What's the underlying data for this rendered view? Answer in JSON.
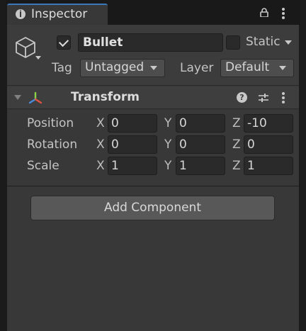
{
  "tab": {
    "label": "Inspector",
    "icon": "info-icon"
  },
  "object": {
    "active": true,
    "name": "Bullet",
    "static_label": "Static",
    "static": false,
    "tag_label": "Tag",
    "tag_value": "Untagged",
    "layer_label": "Layer",
    "layer_value": "Default"
  },
  "transform": {
    "title": "Transform",
    "rows": [
      {
        "label": "Position",
        "x": "0",
        "y": "0",
        "z": "-10"
      },
      {
        "label": "Rotation",
        "x": "0",
        "y": "0",
        "z": "0"
      },
      {
        "label": "Scale",
        "x": "1",
        "y": "1",
        "z": "1"
      }
    ],
    "axis_labels": {
      "x": "X",
      "y": "Y",
      "z": "Z"
    }
  },
  "add_component_label": "Add Component",
  "colors": {
    "accent": "#3a79bb",
    "panel": "#383838",
    "field": "#2a2a2a",
    "axis_x": "#e0543f",
    "axis_y": "#8bd14b",
    "axis_z": "#4a8bdc"
  }
}
